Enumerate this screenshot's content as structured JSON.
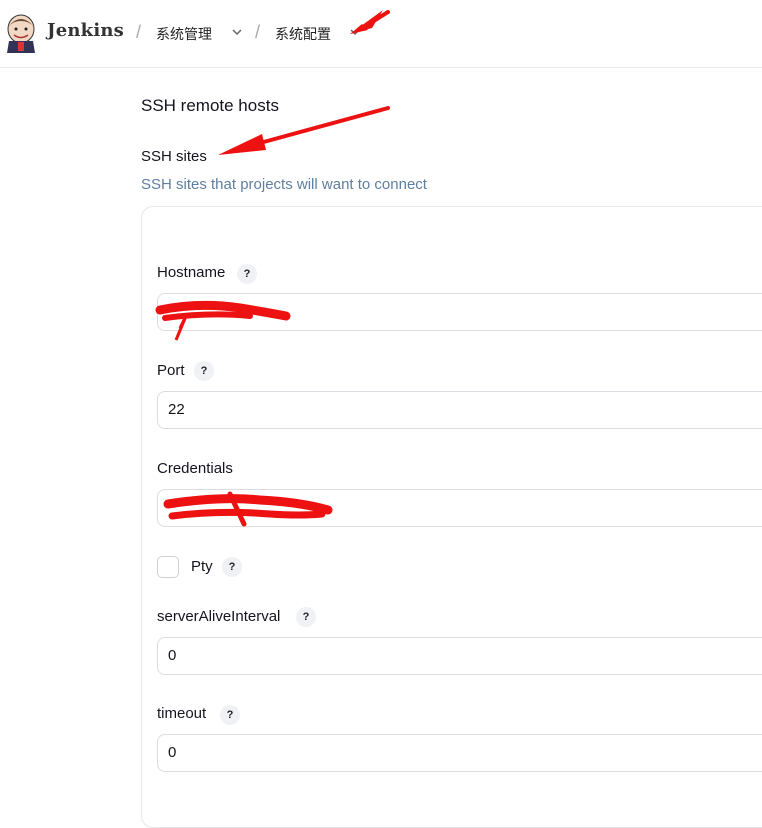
{
  "header": {
    "brand": "Jenkins",
    "breadcrumbs": [
      {
        "label": "系统管理"
      },
      {
        "label": "系统配置"
      }
    ]
  },
  "section": {
    "title": "SSH remote hosts",
    "subtitle": "SSH sites",
    "description": "SSH sites that projects will want to connect"
  },
  "form": {
    "hostname": {
      "label": "Hostname",
      "value": ""
    },
    "port": {
      "label": "Port",
      "value": "22"
    },
    "credentials": {
      "label": "Credentials",
      "value": ""
    },
    "pty": {
      "label": "Pty",
      "checked": false
    },
    "server_alive_interval": {
      "label": "serverAliveInterval",
      "value": "0"
    },
    "timeout": {
      "label": "timeout",
      "value": "0"
    }
  },
  "help_glyph": "?",
  "colors": {
    "annotation": "#ee1111",
    "description": "#5f7fa0",
    "border": "#dcdce2"
  }
}
